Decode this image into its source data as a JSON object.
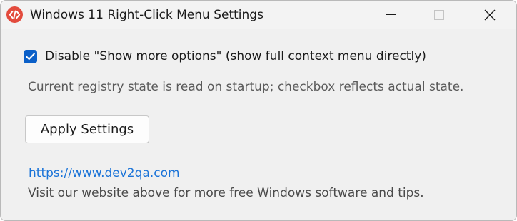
{
  "window": {
    "title": "Windows 11 Right-Click Menu Settings",
    "icon": "code-brackets-icon",
    "controls": [
      "minimize-icon",
      "maximize-icon",
      "close-icon"
    ]
  },
  "settings": {
    "checkbox_label": "Disable \"Show more options\" (show full context menu directly)",
    "checkbox_checked": true,
    "info_text": "Current registry state is read on startup; checkbox reflects actual state.",
    "apply_label": "Apply Settings"
  },
  "footer": {
    "link_text": "https://www.dev2qa.com",
    "note": "Visit our website above for more free Windows software and tips."
  },
  "colors": {
    "accent": "#0a5fc8",
    "link": "#1a73d8",
    "icon_bg": "#e34b3d",
    "window_bg": "#f0f0f0"
  }
}
